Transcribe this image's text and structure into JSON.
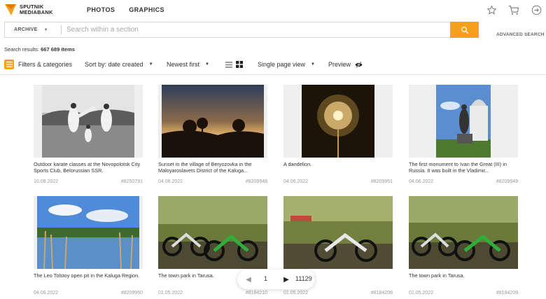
{
  "header": {
    "logo_line1": "SPUTNIK",
    "logo_line2": "MEDIABANK",
    "nav": [
      "PHOTOS",
      "GRAPHICS"
    ],
    "icons": [
      "star-icon",
      "cart-icon",
      "login-icon"
    ]
  },
  "search": {
    "scope": "ARCHIVE",
    "placeholder": "Search within a section",
    "value": "",
    "advanced": "ADVANCED SEARCH"
  },
  "results": {
    "label": "Search results:",
    "count": "667 689 items"
  },
  "toolbar": {
    "filters": "Filters & categories",
    "sort": "Sort by: date created",
    "order": "Newest first",
    "view": "Single page view",
    "preview": "Preview"
  },
  "items": [
    {
      "caption": "Outdoor karate classes at the Novopolotsk City Sports Club, Belorussian SSR.",
      "date": "10.08.2022",
      "id": "#8250791"
    },
    {
      "caption": "Sunset in the village of Beryozovka in the Maloyaroslavets District of the Kaluga...",
      "date": "04.06.2022",
      "id": "#8209948"
    },
    {
      "caption": "A dandelion.",
      "date": "04.06.2022",
      "id": "#8209951"
    },
    {
      "caption": "The first monument to Ivan the Great (III) in Russia. It was built in the Vladimir...",
      "date": "04.06.2022",
      "id": "#8209949"
    },
    {
      "caption": "The Leo Tolstoy open pit in the Kaluga Region.",
      "date": "04.06.2022",
      "id": "#8209950"
    },
    {
      "caption": "The town park in Tarusa.",
      "date": "01.05.2022",
      "id": "#8184210"
    },
    {
      "caption": "...rk in Tarusa.",
      "date": "01.05.2022",
      "id": "#8184208"
    },
    {
      "caption": "The town park in Tarusa.",
      "date": "01.05.2022",
      "id": "#8184209"
    }
  ],
  "pager": {
    "current": "1",
    "total": "11129"
  },
  "colors": {
    "accent": "#f5a11c"
  }
}
